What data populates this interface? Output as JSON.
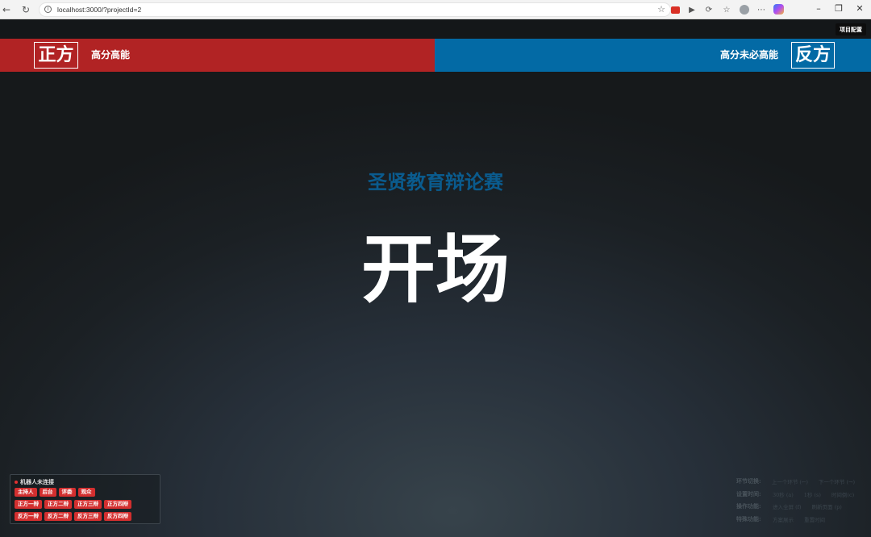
{
  "browser": {
    "url": "localhost:3000/?projectId=2"
  },
  "toolbar": {
    "config_button": "项目配置"
  },
  "pro": {
    "side_label": "正方",
    "topic": "高分高能",
    "color": "#b12324"
  },
  "con": {
    "side_label": "反方",
    "topic": "高分未必高能",
    "color": "#036aa5"
  },
  "main": {
    "event_title": "圣贤教育辩论赛",
    "stage_title": "开场"
  },
  "robot": {
    "status": "机器人未连接",
    "rows": [
      [
        "主持人",
        "后台",
        "评委",
        "观众"
      ],
      [
        "正方一辩",
        "正方二辩",
        "正方三辩",
        "正方四辩"
      ],
      [
        "反方一辩",
        "反方二辩",
        "反方三辩",
        "反方四辩"
      ]
    ]
  },
  "shortcuts": [
    {
      "label": "环节切换:",
      "items": [
        "上一个环节 (←)",
        "下一个环节 (→)"
      ]
    },
    {
      "label": "设置时间:",
      "items": [
        "30秒 (a)",
        "1秒 (s)",
        "时间倒(c)"
      ]
    },
    {
      "label": "操作功能:",
      "items": [
        "进入全屏 (f)",
        "刷新页面 (p)"
      ]
    },
    {
      "label": "特殊功能:",
      "items": [
        "方案展示",
        "重置时间"
      ]
    }
  ]
}
